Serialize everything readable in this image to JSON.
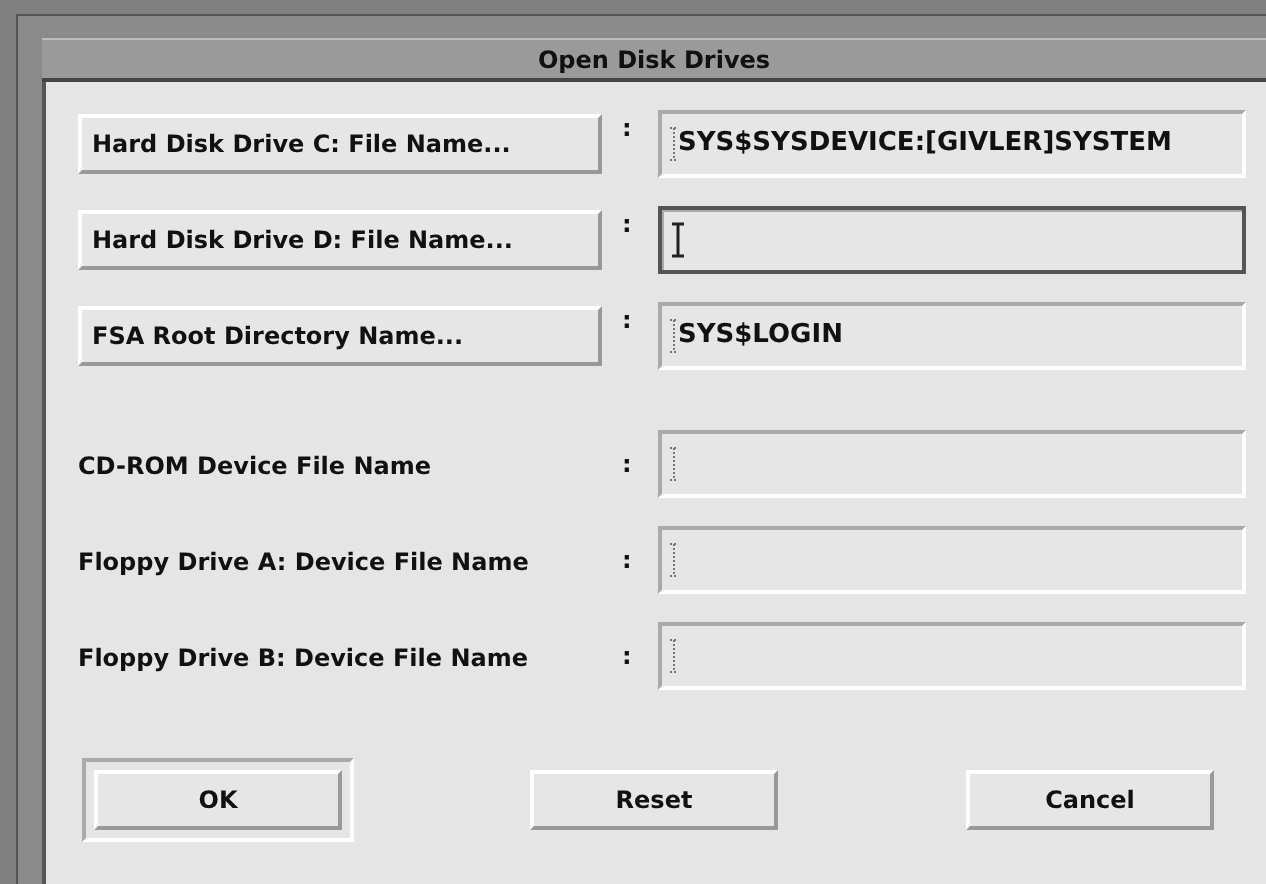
{
  "window": {
    "title": "Open Disk Drives"
  },
  "rows": [
    {
      "kind": "button",
      "label": "Hard Disk Drive C: File Name...",
      "separator": ":",
      "field": {
        "value": "SYS$SYSDEVICE:[GIVLER]SYSTEM",
        "focused": false
      }
    },
    {
      "kind": "button",
      "label": "Hard Disk Drive D: File Name...",
      "separator": ":",
      "field": {
        "focused": true
      }
    },
    {
      "kind": "button",
      "label": "FSA Root Directory Name...",
      "separator": ":",
      "field": {
        "value": "SYS$LOGIN",
        "focused": false
      }
    },
    {
      "kind": "label",
      "label": "CD-ROM Device File Name",
      "separator": ":",
      "field": {
        "focused": false
      }
    },
    {
      "kind": "label",
      "label": "Floppy Drive A: Device File Name",
      "separator": ":",
      "field": {
        "focused": false
      }
    },
    {
      "kind": "label",
      "label": "Floppy Drive B: Device File Name",
      "separator": ":",
      "field": {
        "focused": false
      }
    }
  ],
  "buttons": [
    {
      "label": "OK",
      "default": true
    },
    {
      "label": "Reset",
      "default": false
    },
    {
      "label": "Cancel",
      "default": false
    }
  ]
}
